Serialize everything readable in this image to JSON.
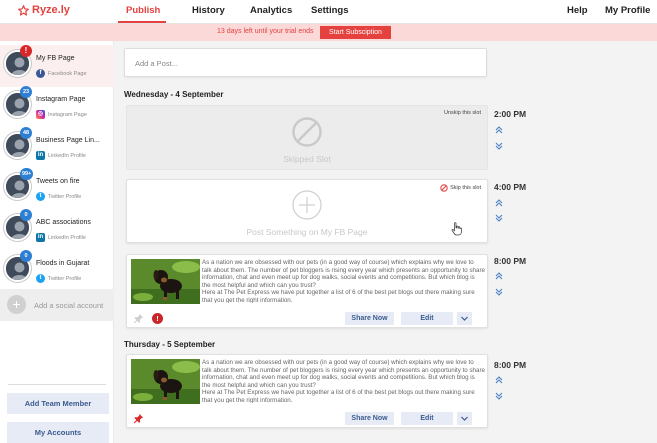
{
  "app": {
    "name": "Ryze.ly",
    "brand_color": "#e4413f"
  },
  "nav": {
    "tabs": [
      {
        "label": "Publish",
        "active": true
      },
      {
        "label": "History"
      },
      {
        "label": "Analytics"
      },
      {
        "label": "Settings"
      }
    ],
    "right": [
      {
        "label": "Help"
      },
      {
        "label": "My Profile"
      }
    ]
  },
  "banner": {
    "text": "13 days left until your trial ends",
    "button": "Start Subsciption"
  },
  "sidebar": {
    "profiles": [
      {
        "name": "My FB Page",
        "network": "Facebook Page",
        "icon": "facebook-icon",
        "badge": "!",
        "badge_type": "alert",
        "selected": true
      },
      {
        "name": "Instagram Page",
        "network": "Instagram Page",
        "icon": "instagram-icon",
        "badge": "23",
        "badge_type": "count"
      },
      {
        "name": "Business Page Lin...",
        "network": "LinkedIn Profile",
        "icon": "linkedin-icon",
        "badge": "48",
        "badge_type": "count"
      },
      {
        "name": "Tweets on fire",
        "network": "Twitter Profile",
        "icon": "twitter-icon",
        "badge": "99+",
        "badge_type": "count"
      },
      {
        "name": "ABC associations",
        "network": "LinkedIn Profile",
        "icon": "linkedin-icon",
        "badge": "0",
        "badge_type": "count"
      },
      {
        "name": "Floods in Gujarat",
        "network": "Twitter Profile",
        "icon": "twitter-icon",
        "badge": "0",
        "badge_type": "count"
      }
    ],
    "add_social": "Add a social account",
    "add_team": "Add Team Member",
    "my_accounts": "My Accounts"
  },
  "composer": {
    "placeholder": "Add a Post..."
  },
  "days": [
    {
      "label": "Wednesday - 4 September"
    },
    {
      "label": "Thursday - 5 September"
    }
  ],
  "slots": {
    "skipped": {
      "time": "2:00 PM",
      "action": "Unskip this slot",
      "caption": "Skipped Slot"
    },
    "empty": {
      "time": "4:00 PM",
      "action": "Skip this slot",
      "caption": "Post Something on My FB Page"
    },
    "post1": {
      "time": "8:00 PM",
      "share": "Share Now",
      "edit": "Edit",
      "has_error": true,
      "error_symbol": "!"
    },
    "post2": {
      "time": "8:00 PM",
      "share": "Share Now",
      "edit": "Edit",
      "pinned": true
    }
  },
  "post_text": {
    "para1": "As a nation we are obsessed with our pets (in a good way of course) which explains why we love to talk about them. The number of pet bloggers is rising every year which presents an opportunity to share information, chat and even meet up for dog walks, social events and competitions. But which blog is the most helpful and which can you trust?",
    "para2": "Here at The Pet Express we have put together a list of 6 of the best pet blogs out there making sure that you get the right information."
  }
}
